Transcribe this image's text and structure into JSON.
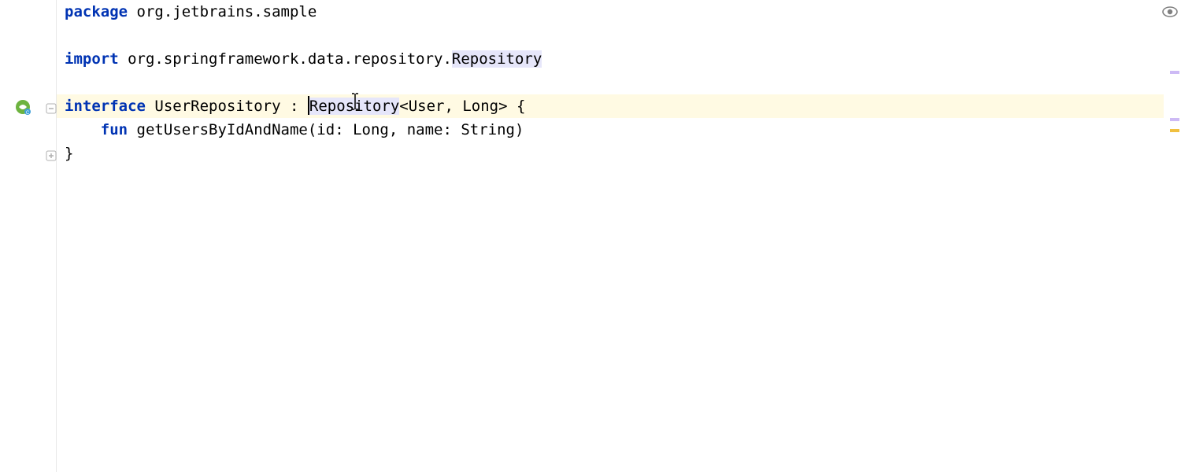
{
  "code": {
    "line1": {
      "keyword": "package",
      "rest": " org.jetbrains.sample"
    },
    "line3": {
      "keyword": "import",
      "prefix": " org.springframework.data.repository.",
      "highlighted": "Repository"
    },
    "line5": {
      "keyword": "interface",
      "name": " UserRepository ",
      "colon": ": ",
      "highlighted": "Repository",
      "generics": "<User, Long> {"
    },
    "line6": {
      "indent": "    ",
      "keyword": "fun",
      "signature": " getUsersByIdAndName(id: Long, name: String)"
    },
    "line7": {
      "text": "}"
    }
  },
  "icons": {
    "spring": "spring-bean-icon",
    "fold_open": "fold-open-icon",
    "fold_close": "fold-close-icon",
    "inspection": "inspection-eye-icon"
  },
  "colors": {
    "keyword": "#0033b3",
    "highlight_bg": "#fffae3",
    "usage_bg": "#e6e6fa",
    "marker_violet": "#cdbaf5",
    "marker_yellow": "#f0c040"
  }
}
